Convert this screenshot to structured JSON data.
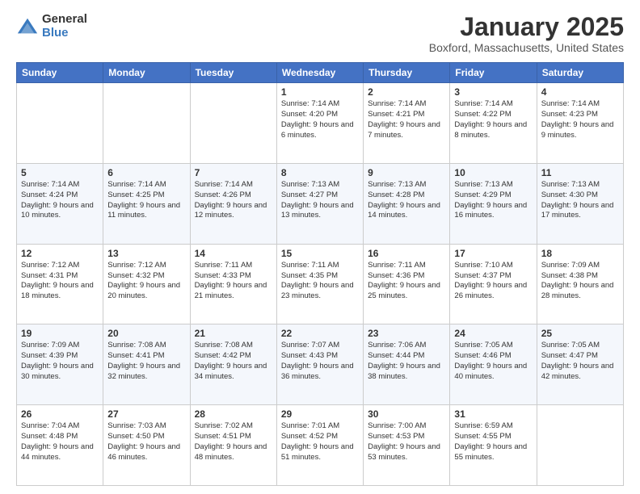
{
  "header": {
    "logo_general": "General",
    "logo_blue": "Blue",
    "month_title": "January 2025",
    "location": "Boxford, Massachusetts, United States"
  },
  "days_of_week": [
    "Sunday",
    "Monday",
    "Tuesday",
    "Wednesday",
    "Thursday",
    "Friday",
    "Saturday"
  ],
  "weeks": [
    [
      {
        "day": "",
        "info": ""
      },
      {
        "day": "",
        "info": ""
      },
      {
        "day": "",
        "info": ""
      },
      {
        "day": "1",
        "info": "Sunrise: 7:14 AM\nSunset: 4:20 PM\nDaylight: 9 hours and 6 minutes."
      },
      {
        "day": "2",
        "info": "Sunrise: 7:14 AM\nSunset: 4:21 PM\nDaylight: 9 hours and 7 minutes."
      },
      {
        "day": "3",
        "info": "Sunrise: 7:14 AM\nSunset: 4:22 PM\nDaylight: 9 hours and 8 minutes."
      },
      {
        "day": "4",
        "info": "Sunrise: 7:14 AM\nSunset: 4:23 PM\nDaylight: 9 hours and 9 minutes."
      }
    ],
    [
      {
        "day": "5",
        "info": "Sunrise: 7:14 AM\nSunset: 4:24 PM\nDaylight: 9 hours and 10 minutes."
      },
      {
        "day": "6",
        "info": "Sunrise: 7:14 AM\nSunset: 4:25 PM\nDaylight: 9 hours and 11 minutes."
      },
      {
        "day": "7",
        "info": "Sunrise: 7:14 AM\nSunset: 4:26 PM\nDaylight: 9 hours and 12 minutes."
      },
      {
        "day": "8",
        "info": "Sunrise: 7:13 AM\nSunset: 4:27 PM\nDaylight: 9 hours and 13 minutes."
      },
      {
        "day": "9",
        "info": "Sunrise: 7:13 AM\nSunset: 4:28 PM\nDaylight: 9 hours and 14 minutes."
      },
      {
        "day": "10",
        "info": "Sunrise: 7:13 AM\nSunset: 4:29 PM\nDaylight: 9 hours and 16 minutes."
      },
      {
        "day": "11",
        "info": "Sunrise: 7:13 AM\nSunset: 4:30 PM\nDaylight: 9 hours and 17 minutes."
      }
    ],
    [
      {
        "day": "12",
        "info": "Sunrise: 7:12 AM\nSunset: 4:31 PM\nDaylight: 9 hours and 18 minutes."
      },
      {
        "day": "13",
        "info": "Sunrise: 7:12 AM\nSunset: 4:32 PM\nDaylight: 9 hours and 20 minutes."
      },
      {
        "day": "14",
        "info": "Sunrise: 7:11 AM\nSunset: 4:33 PM\nDaylight: 9 hours and 21 minutes."
      },
      {
        "day": "15",
        "info": "Sunrise: 7:11 AM\nSunset: 4:35 PM\nDaylight: 9 hours and 23 minutes."
      },
      {
        "day": "16",
        "info": "Sunrise: 7:11 AM\nSunset: 4:36 PM\nDaylight: 9 hours and 25 minutes."
      },
      {
        "day": "17",
        "info": "Sunrise: 7:10 AM\nSunset: 4:37 PM\nDaylight: 9 hours and 26 minutes."
      },
      {
        "day": "18",
        "info": "Sunrise: 7:09 AM\nSunset: 4:38 PM\nDaylight: 9 hours and 28 minutes."
      }
    ],
    [
      {
        "day": "19",
        "info": "Sunrise: 7:09 AM\nSunset: 4:39 PM\nDaylight: 9 hours and 30 minutes."
      },
      {
        "day": "20",
        "info": "Sunrise: 7:08 AM\nSunset: 4:41 PM\nDaylight: 9 hours and 32 minutes."
      },
      {
        "day": "21",
        "info": "Sunrise: 7:08 AM\nSunset: 4:42 PM\nDaylight: 9 hours and 34 minutes."
      },
      {
        "day": "22",
        "info": "Sunrise: 7:07 AM\nSunset: 4:43 PM\nDaylight: 9 hours and 36 minutes."
      },
      {
        "day": "23",
        "info": "Sunrise: 7:06 AM\nSunset: 4:44 PM\nDaylight: 9 hours and 38 minutes."
      },
      {
        "day": "24",
        "info": "Sunrise: 7:05 AM\nSunset: 4:46 PM\nDaylight: 9 hours and 40 minutes."
      },
      {
        "day": "25",
        "info": "Sunrise: 7:05 AM\nSunset: 4:47 PM\nDaylight: 9 hours and 42 minutes."
      }
    ],
    [
      {
        "day": "26",
        "info": "Sunrise: 7:04 AM\nSunset: 4:48 PM\nDaylight: 9 hours and 44 minutes."
      },
      {
        "day": "27",
        "info": "Sunrise: 7:03 AM\nSunset: 4:50 PM\nDaylight: 9 hours and 46 minutes."
      },
      {
        "day": "28",
        "info": "Sunrise: 7:02 AM\nSunset: 4:51 PM\nDaylight: 9 hours and 48 minutes."
      },
      {
        "day": "29",
        "info": "Sunrise: 7:01 AM\nSunset: 4:52 PM\nDaylight: 9 hours and 51 minutes."
      },
      {
        "day": "30",
        "info": "Sunrise: 7:00 AM\nSunset: 4:53 PM\nDaylight: 9 hours and 53 minutes."
      },
      {
        "day": "31",
        "info": "Sunrise: 6:59 AM\nSunset: 4:55 PM\nDaylight: 9 hours and 55 minutes."
      },
      {
        "day": "",
        "info": ""
      }
    ]
  ]
}
